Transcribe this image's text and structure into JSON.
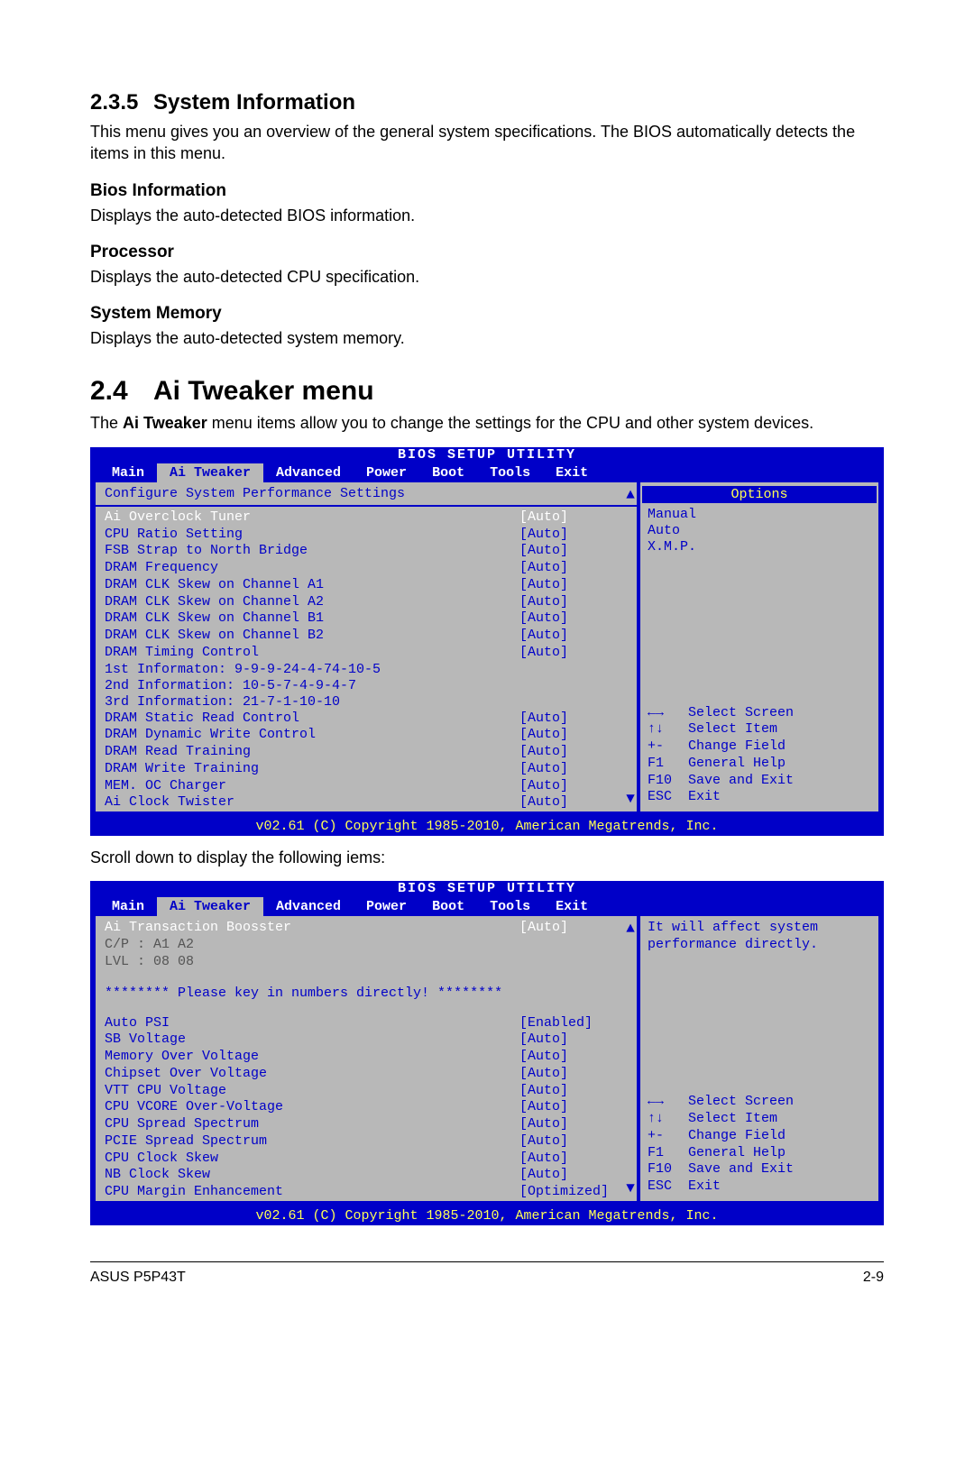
{
  "sec235": {
    "num": "2.3.5",
    "title": "System Information",
    "intro": "This menu gives you an overview of the general system specifications. The BIOS automatically detects the items in this menu.",
    "sub": [
      {
        "h": "Bios Information",
        "p": "Displays the auto-detected BIOS information."
      },
      {
        "h": "Processor",
        "p": "Displays the auto-detected CPU specification."
      },
      {
        "h": "System Memory",
        "p": "Displays the auto-detected system memory."
      }
    ]
  },
  "sec24": {
    "num": "2.4",
    "title": "Ai Tweaker menu",
    "para_pre": "The ",
    "para_bold": "Ai Tweaker",
    "para_post": " menu items allow you to change the settings for the CPU and other system devices."
  },
  "bios_common": {
    "title": "BIOS SETUP UTILITY",
    "tabs": [
      "Main",
      "Ai Tweaker",
      "Advanced",
      "Power",
      "Boot",
      "Tools",
      "Exit"
    ],
    "active_tab": 1,
    "keys": [
      {
        "sym": "←→",
        "txt": "Select Screen"
      },
      {
        "sym": "↑↓",
        "txt": "Select Item"
      },
      {
        "sym": "+-",
        "txt": "Change Field"
      },
      {
        "sym": "F1",
        "txt": "General Help"
      },
      {
        "sym": "F10",
        "txt": "Save and Exit"
      },
      {
        "sym": "ESC",
        "txt": "Exit"
      }
    ],
    "footer": "v02.61 (C) Copyright 1985-2010, American Megatrends, Inc."
  },
  "bios1": {
    "heading": "Configure System Performance Settings",
    "options_header": "Options",
    "options": [
      "Manual",
      "Auto",
      "X.M.P."
    ],
    "rows": [
      {
        "lbl": "Ai Overclock Tuner",
        "val": "[Auto]",
        "sel": true
      },
      {
        "lbl": "CPU Ratio Setting",
        "val": "[Auto]"
      },
      {
        "lbl": "FSB Strap to North Bridge",
        "val": "[Auto]"
      },
      {
        "lbl": "DRAM Frequency",
        "val": "[Auto]"
      },
      {
        "lbl": "DRAM CLK Skew on Channel A1",
        "val": "[Auto]"
      },
      {
        "lbl": "DRAM CLK Skew on Channel A2",
        "val": "[Auto]"
      },
      {
        "lbl": "DRAM CLK Skew on Channel B1",
        "val": "[Auto]"
      },
      {
        "lbl": "DRAM CLK Skew on Channel B2",
        "val": "[Auto]"
      },
      {
        "lbl": "DRAM Timing Control",
        "val": "[Auto]"
      }
    ],
    "info_lines": [
      "  1st Informaton: 9-9-9-24-4-74-10-5",
      "  2nd Information: 10-5-7-4-9-4-7",
      "  3rd Information: 21-7-1-10-10"
    ],
    "rows2": [
      {
        "lbl": "DRAM Static Read Control",
        "val": "[Auto]"
      },
      {
        "lbl": "DRAM Dynamic Write Control",
        "val": "[Auto]"
      },
      {
        "lbl": "DRAM Read Training",
        "val": "[Auto]"
      },
      {
        "lbl": "DRAM Write Training",
        "val": "[Auto]"
      },
      {
        "lbl": "MEM. OC Charger",
        "val": "[Auto]"
      },
      {
        "lbl": "Ai Clock Twister",
        "val": "[Auto]"
      }
    ]
  },
  "interlude": "Scroll down to display the following iems:",
  "bios2": {
    "note_lines": [
      "It will affect system",
      "performance directly."
    ],
    "top_row": {
      "lbl": "Ai Transaction Boosster",
      "val": "[Auto]",
      "sel": true
    },
    "dim_lines": [
      "  C/P : A1 A2",
      "  LVL : 08 08"
    ],
    "stars": "******** Please key in numbers directly! ********",
    "rows": [
      {
        "lbl": "Auto PSI",
        "val": "[Enabled]"
      },
      {
        "lbl": "SB Voltage",
        "val": "[Auto]"
      },
      {
        "lbl": "Memory Over Voltage",
        "val": "[Auto]"
      },
      {
        "lbl": "Chipset Over Voltage",
        "val": "[Auto]"
      },
      {
        "lbl": "VTT CPU Voltage",
        "val": "[Auto]"
      },
      {
        "lbl": "CPU VCORE Over-Voltage",
        "val": "[Auto]"
      },
      {
        "lbl": "CPU Spread Spectrum",
        "val": "[Auto]"
      },
      {
        "lbl": "PCIE Spread Spectrum",
        "val": "[Auto]"
      },
      {
        "lbl": "CPU Clock Skew",
        "val": "[Auto]"
      },
      {
        "lbl": "NB Clock Skew",
        "val": "[Auto]"
      },
      {
        "lbl": "CPU Margin Enhancement",
        "val": "[Optimized]"
      }
    ]
  },
  "page_foot": {
    "left": "ASUS P5P43T",
    "right": "2-9"
  }
}
